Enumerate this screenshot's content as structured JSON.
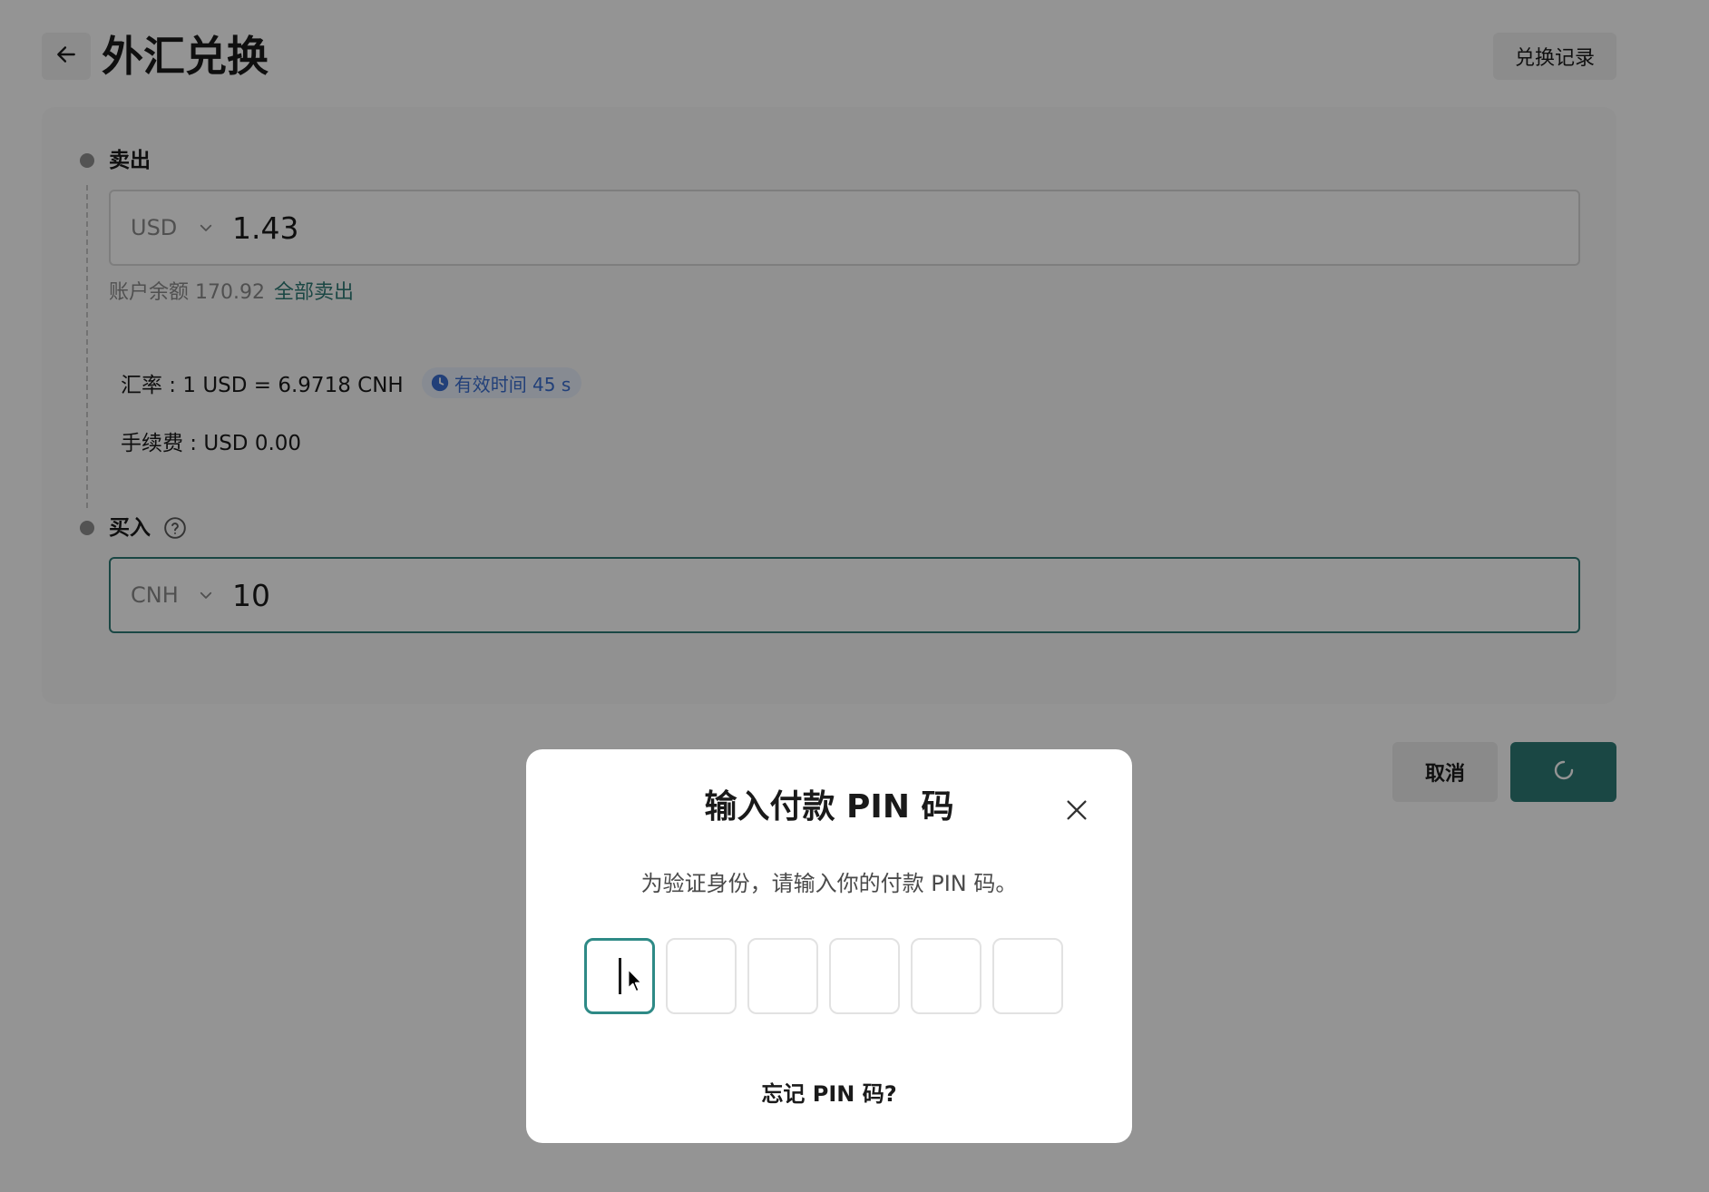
{
  "header": {
    "title": "外汇兑换",
    "history_label": "兑换记录"
  },
  "sell": {
    "label": "卖出",
    "currency": "USD",
    "amount": "1.43",
    "balance_text": "账户余额 170.92",
    "sell_all_label": "全部卖出"
  },
  "rate": {
    "text": "汇率 : 1 USD = 6.9718 CNH",
    "validity_text": "有效时间 45 s",
    "fee_text": "手续费 : USD 0.00"
  },
  "buy": {
    "label": "买入",
    "currency": "CNH",
    "amount": "10"
  },
  "actions": {
    "cancel_label": "取消"
  },
  "modal": {
    "title": "输入付款 PIN 码",
    "description": "为验证身份，请输入你的付款 PIN 码。",
    "pin_length": 6,
    "forgot_label": "忘记 PIN 码?"
  },
  "colors": {
    "accent": "#2e7a76",
    "badge_text": "#3b6fd1",
    "badge_bg": "#e8f0fb"
  }
}
